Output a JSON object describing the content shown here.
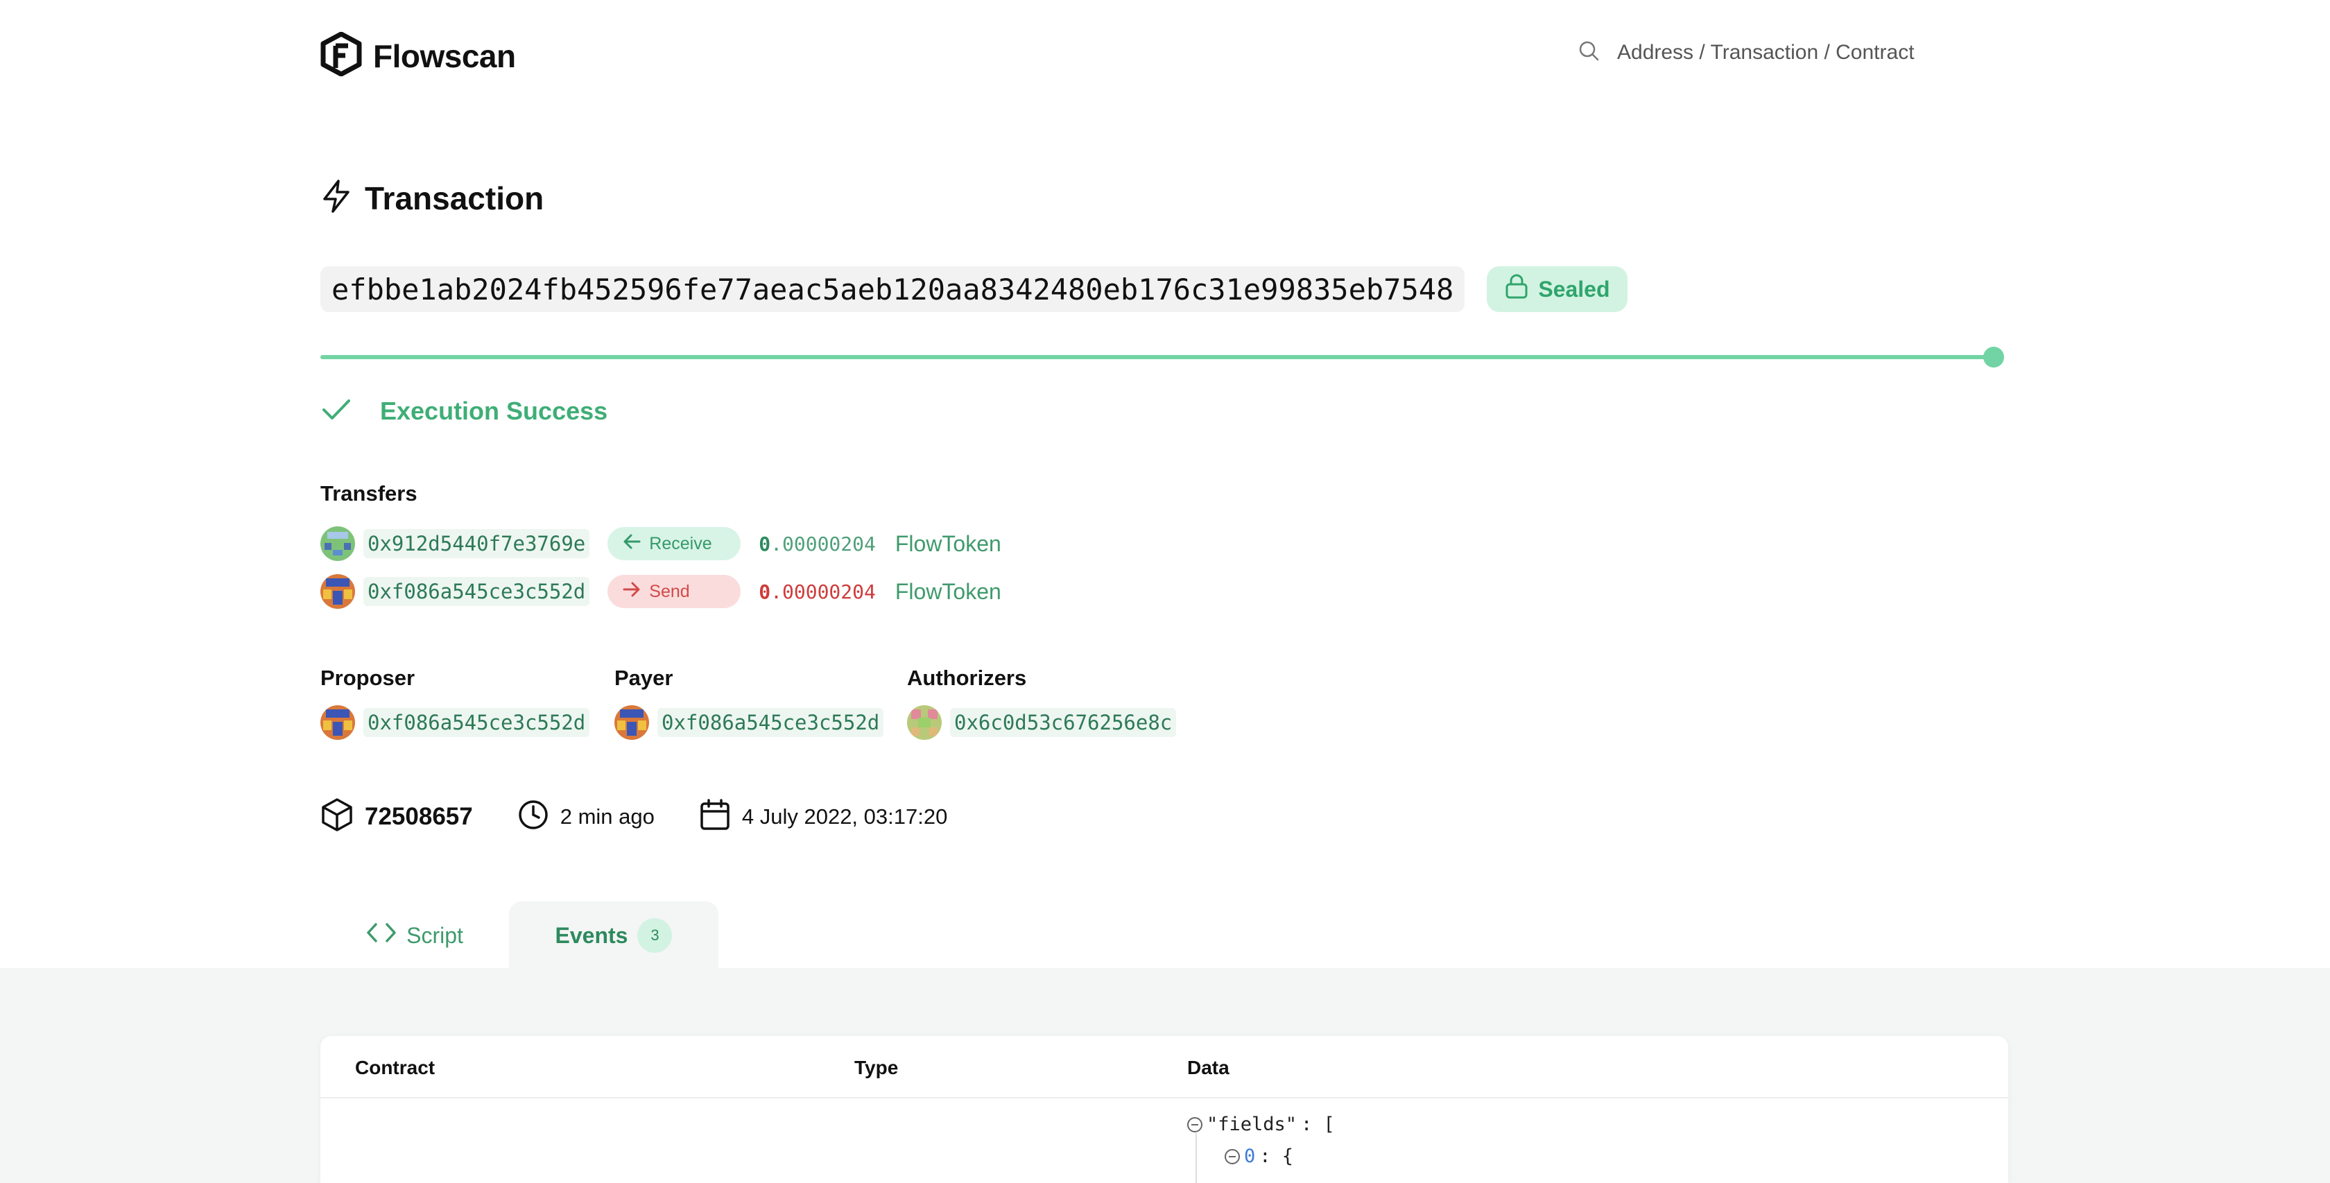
{
  "header": {
    "logo_text": "Flowscan",
    "search_placeholder": "Address / Transaction / Contract"
  },
  "page": {
    "title": "Transaction",
    "tx_hash": "efbbe1ab2024fb452596fe77aeac5aeb120aa8342480eb176c31e99835eb7548",
    "status_badge": "Sealed",
    "progress_fraction": 1.0,
    "execution_status": "Execution Success"
  },
  "transfers": {
    "label": "Transfers",
    "items": [
      {
        "address": "0x912d5440f7e3769e",
        "direction": "Receive",
        "amount_int": "0",
        "amount_frac": ".00000204",
        "token": "FlowToken"
      },
      {
        "address": "0xf086a545ce3c552d",
        "direction": "Send",
        "amount_int": "0",
        "amount_frac": ".00000204",
        "token": "FlowToken"
      }
    ]
  },
  "roles": {
    "proposer_label": "Proposer",
    "proposer_address": "0xf086a545ce3c552d",
    "payer_label": "Payer",
    "payer_address": "0xf086a545ce3c552d",
    "authorizers_label": "Authorizers",
    "authorizer_address": "0x6c0d53c676256e8c"
  },
  "meta": {
    "block_height": "72508657",
    "relative_time": "2 min ago",
    "timestamp": "4 July 2022, 03:17:20"
  },
  "tabs": {
    "script_label": "Script",
    "events_label": "Events",
    "events_count": "3"
  },
  "events_table": {
    "columns": [
      "Contract",
      "Type",
      "Data"
    ],
    "json_line_1_key": "\"fields\"",
    "json_line_1_rest": ": [",
    "json_line_2_idx": "0",
    "json_line_2_rest": ": {"
  },
  "colors": {
    "accent_green": "#3fae76",
    "progress_green": "#72d4a4",
    "send_red": "#d24a4a"
  }
}
